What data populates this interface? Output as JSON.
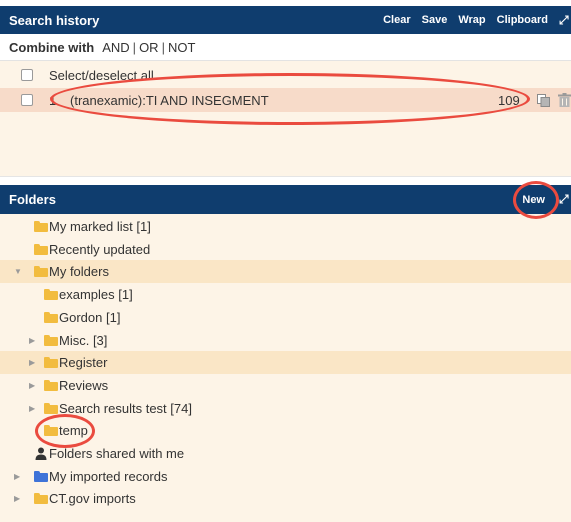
{
  "search_history": {
    "title": "Search history",
    "actions": [
      "Clear",
      "Save",
      "Wrap",
      "Clipboard"
    ],
    "combine_label": "Combine with",
    "operators": [
      "AND",
      "OR",
      "NOT"
    ],
    "select_all_label": "Select/deselect all",
    "rows": [
      {
        "number": "1",
        "query": "(tranexamic):TI AND INSEGMENT",
        "hits": "109"
      }
    ]
  },
  "folders": {
    "title": "Folders",
    "new_label": "New",
    "items": [
      {
        "label": "My marked list [1]",
        "icon": "folder-icon",
        "color": "#f2bc3f"
      },
      {
        "label": "Recently updated",
        "icon": "folder-icon",
        "color": "#f2bc3f"
      },
      {
        "label": "My folders",
        "icon": "folder-icon",
        "color": "#f2bc3f",
        "state": "expanded"
      },
      {
        "label": "examples [1]",
        "icon": "folder-icon",
        "color": "#f2bc3f"
      },
      {
        "label": "Gordon [1]",
        "icon": "folder-icon",
        "color": "#f2bc3f"
      },
      {
        "label": "Misc. [3]",
        "icon": "folder-icon",
        "color": "#f2bc3f",
        "state": "collapsed"
      },
      {
        "label": "Register",
        "icon": "folder-icon",
        "color": "#f2bc3f",
        "state": "collapsed"
      },
      {
        "label": "Reviews",
        "icon": "folder-icon",
        "color": "#f2bc3f",
        "state": "collapsed"
      },
      {
        "label": "Search results test [74]",
        "icon": "folder-icon",
        "color": "#f2bc3f",
        "state": "collapsed"
      },
      {
        "label": "temp",
        "icon": "folder-icon",
        "color": "#f2bc3f"
      },
      {
        "label": "Folders shared with me",
        "icon": "person-icon",
        "color": "#333333"
      },
      {
        "label": "My imported records",
        "icon": "folder-icon",
        "color": "#3f73d8",
        "state": "collapsed"
      },
      {
        "label": "CT.gov imports",
        "icon": "folder-icon",
        "color": "#f2bc3f",
        "state": "collapsed"
      }
    ]
  },
  "colors": {
    "header_bg": "#0f3d6e",
    "panel_bg": "#fdf4e7",
    "highlight_row": "#f7dbc9",
    "annotation_red": "#ea4b3f"
  }
}
